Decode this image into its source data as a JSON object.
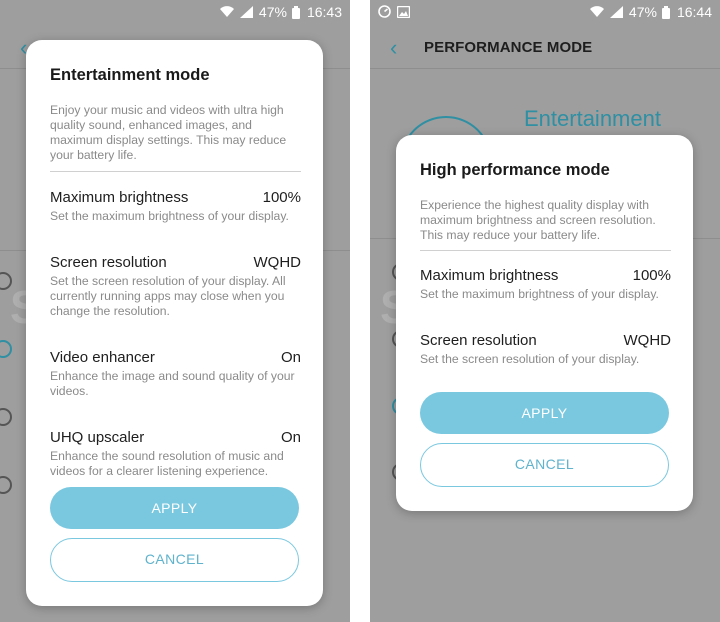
{
  "left": {
    "status": {
      "battery": "47%",
      "time": "16:43"
    },
    "dialog": {
      "title": "Entertainment mode",
      "description": "Enjoy your music and videos with ultra high quality sound, enhanced images, and maximum display settings. This may reduce your battery life.",
      "settings": [
        {
          "name": "Maximum brightness",
          "value": "100%",
          "desc": "Set the maximum brightness of your display."
        },
        {
          "name": "Screen resolution",
          "value": "WQHD",
          "desc": "Set the screen resolution of your display. All currently running apps may close when you change the resolution."
        },
        {
          "name": "Video enhancer",
          "value": "On",
          "desc": "Enhance the image and sound quality of your videos."
        },
        {
          "name": "UHQ upscaler",
          "value": "On",
          "desc": "Enhance the sound resolution of music and videos for a clearer listening experience."
        }
      ],
      "apply_label": "APPLY",
      "cancel_label": "CANCEL"
    }
  },
  "right": {
    "status": {
      "battery": "47%",
      "time": "16:44"
    },
    "header": {
      "back_icon": "chevron-left-icon",
      "title": "PERFORMANCE MODE"
    },
    "background_mode_label": "Entertainment",
    "dialog": {
      "title": "High performance mode",
      "description": "Experience the highest quality display with maximum brightness and screen resolution. This may reduce your battery life.",
      "settings": [
        {
          "name": "Maximum brightness",
          "value": "100%",
          "desc": "Set the maximum brightness of your display."
        },
        {
          "name": "Screen resolution",
          "value": "WQHD",
          "desc": "Set the screen resolution of your display."
        }
      ],
      "apply_label": "APPLY",
      "cancel_label": "CANCEL"
    }
  },
  "watermark": {
    "bold": "SAM",
    "thin": "MOBILE"
  },
  "colors": {
    "accent": "#7ac8e0",
    "teal": "#2f8fa3",
    "dim_overlay": "#9e9e9e"
  }
}
